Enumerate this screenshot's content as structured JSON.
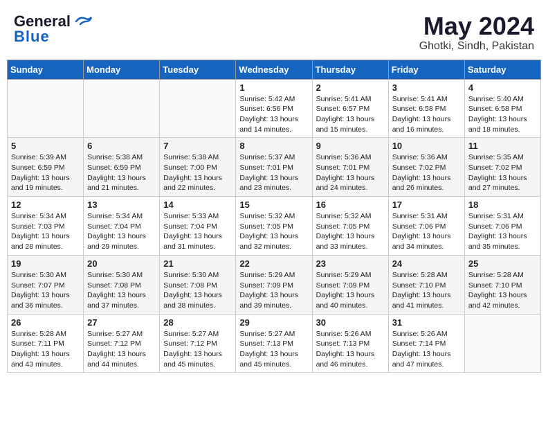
{
  "header": {
    "logo_line1": "General",
    "logo_line2": "Blue",
    "month": "May 2024",
    "location": "Ghotki, Sindh, Pakistan"
  },
  "weekdays": [
    "Sunday",
    "Monday",
    "Tuesday",
    "Wednesday",
    "Thursday",
    "Friday",
    "Saturday"
  ],
  "weeks": [
    [
      {
        "day": "",
        "sunrise": "",
        "sunset": "",
        "daylight": ""
      },
      {
        "day": "",
        "sunrise": "",
        "sunset": "",
        "daylight": ""
      },
      {
        "day": "",
        "sunrise": "",
        "sunset": "",
        "daylight": ""
      },
      {
        "day": "1",
        "sunrise": "Sunrise: 5:42 AM",
        "sunset": "Sunset: 6:56 PM",
        "daylight": "Daylight: 13 hours and 14 minutes."
      },
      {
        "day": "2",
        "sunrise": "Sunrise: 5:41 AM",
        "sunset": "Sunset: 6:57 PM",
        "daylight": "Daylight: 13 hours and 15 minutes."
      },
      {
        "day": "3",
        "sunrise": "Sunrise: 5:41 AM",
        "sunset": "Sunset: 6:58 PM",
        "daylight": "Daylight: 13 hours and 16 minutes."
      },
      {
        "day": "4",
        "sunrise": "Sunrise: 5:40 AM",
        "sunset": "Sunset: 6:58 PM",
        "daylight": "Daylight: 13 hours and 18 minutes."
      }
    ],
    [
      {
        "day": "5",
        "sunrise": "Sunrise: 5:39 AM",
        "sunset": "Sunset: 6:59 PM",
        "daylight": "Daylight: 13 hours and 19 minutes."
      },
      {
        "day": "6",
        "sunrise": "Sunrise: 5:38 AM",
        "sunset": "Sunset: 6:59 PM",
        "daylight": "Daylight: 13 hours and 21 minutes."
      },
      {
        "day": "7",
        "sunrise": "Sunrise: 5:38 AM",
        "sunset": "Sunset: 7:00 PM",
        "daylight": "Daylight: 13 hours and 22 minutes."
      },
      {
        "day": "8",
        "sunrise": "Sunrise: 5:37 AM",
        "sunset": "Sunset: 7:01 PM",
        "daylight": "Daylight: 13 hours and 23 minutes."
      },
      {
        "day": "9",
        "sunrise": "Sunrise: 5:36 AM",
        "sunset": "Sunset: 7:01 PM",
        "daylight": "Daylight: 13 hours and 24 minutes."
      },
      {
        "day": "10",
        "sunrise": "Sunrise: 5:36 AM",
        "sunset": "Sunset: 7:02 PM",
        "daylight": "Daylight: 13 hours and 26 minutes."
      },
      {
        "day": "11",
        "sunrise": "Sunrise: 5:35 AM",
        "sunset": "Sunset: 7:02 PM",
        "daylight": "Daylight: 13 hours and 27 minutes."
      }
    ],
    [
      {
        "day": "12",
        "sunrise": "Sunrise: 5:34 AM",
        "sunset": "Sunset: 7:03 PM",
        "daylight": "Daylight: 13 hours and 28 minutes."
      },
      {
        "day": "13",
        "sunrise": "Sunrise: 5:34 AM",
        "sunset": "Sunset: 7:04 PM",
        "daylight": "Daylight: 13 hours and 29 minutes."
      },
      {
        "day": "14",
        "sunrise": "Sunrise: 5:33 AM",
        "sunset": "Sunset: 7:04 PM",
        "daylight": "Daylight: 13 hours and 31 minutes."
      },
      {
        "day": "15",
        "sunrise": "Sunrise: 5:32 AM",
        "sunset": "Sunset: 7:05 PM",
        "daylight": "Daylight: 13 hours and 32 minutes."
      },
      {
        "day": "16",
        "sunrise": "Sunrise: 5:32 AM",
        "sunset": "Sunset: 7:05 PM",
        "daylight": "Daylight: 13 hours and 33 minutes."
      },
      {
        "day": "17",
        "sunrise": "Sunrise: 5:31 AM",
        "sunset": "Sunset: 7:06 PM",
        "daylight": "Daylight: 13 hours and 34 minutes."
      },
      {
        "day": "18",
        "sunrise": "Sunrise: 5:31 AM",
        "sunset": "Sunset: 7:06 PM",
        "daylight": "Daylight: 13 hours and 35 minutes."
      }
    ],
    [
      {
        "day": "19",
        "sunrise": "Sunrise: 5:30 AM",
        "sunset": "Sunset: 7:07 PM",
        "daylight": "Daylight: 13 hours and 36 minutes."
      },
      {
        "day": "20",
        "sunrise": "Sunrise: 5:30 AM",
        "sunset": "Sunset: 7:08 PM",
        "daylight": "Daylight: 13 hours and 37 minutes."
      },
      {
        "day": "21",
        "sunrise": "Sunrise: 5:30 AM",
        "sunset": "Sunset: 7:08 PM",
        "daylight": "Daylight: 13 hours and 38 minutes."
      },
      {
        "day": "22",
        "sunrise": "Sunrise: 5:29 AM",
        "sunset": "Sunset: 7:09 PM",
        "daylight": "Daylight: 13 hours and 39 minutes."
      },
      {
        "day": "23",
        "sunrise": "Sunrise: 5:29 AM",
        "sunset": "Sunset: 7:09 PM",
        "daylight": "Daylight: 13 hours and 40 minutes."
      },
      {
        "day": "24",
        "sunrise": "Sunrise: 5:28 AM",
        "sunset": "Sunset: 7:10 PM",
        "daylight": "Daylight: 13 hours and 41 minutes."
      },
      {
        "day": "25",
        "sunrise": "Sunrise: 5:28 AM",
        "sunset": "Sunset: 7:10 PM",
        "daylight": "Daylight: 13 hours and 42 minutes."
      }
    ],
    [
      {
        "day": "26",
        "sunrise": "Sunrise: 5:28 AM",
        "sunset": "Sunset: 7:11 PM",
        "daylight": "Daylight: 13 hours and 43 minutes."
      },
      {
        "day": "27",
        "sunrise": "Sunrise: 5:27 AM",
        "sunset": "Sunset: 7:12 PM",
        "daylight": "Daylight: 13 hours and 44 minutes."
      },
      {
        "day": "28",
        "sunrise": "Sunrise: 5:27 AM",
        "sunset": "Sunset: 7:12 PM",
        "daylight": "Daylight: 13 hours and 45 minutes."
      },
      {
        "day": "29",
        "sunrise": "Sunrise: 5:27 AM",
        "sunset": "Sunset: 7:13 PM",
        "daylight": "Daylight: 13 hours and 45 minutes."
      },
      {
        "day": "30",
        "sunrise": "Sunrise: 5:26 AM",
        "sunset": "Sunset: 7:13 PM",
        "daylight": "Daylight: 13 hours and 46 minutes."
      },
      {
        "day": "31",
        "sunrise": "Sunrise: 5:26 AM",
        "sunset": "Sunset: 7:14 PM",
        "daylight": "Daylight: 13 hours and 47 minutes."
      },
      {
        "day": "",
        "sunrise": "",
        "sunset": "",
        "daylight": ""
      }
    ]
  ]
}
